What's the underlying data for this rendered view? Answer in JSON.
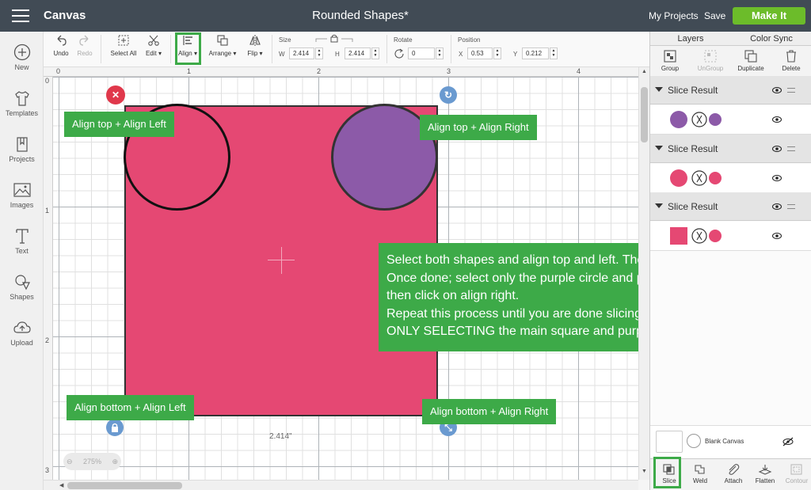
{
  "topbar": {
    "app_title": "Canvas",
    "document_title": "Rounded Shapes*",
    "my_projects": "My Projects",
    "save": "Save",
    "make_it": "Make It"
  },
  "left_rail": [
    {
      "label": "New",
      "icon": "plus-circle-icon"
    },
    {
      "label": "Templates",
      "icon": "tshirt-icon"
    },
    {
      "label": "Projects",
      "icon": "bookmark-icon"
    },
    {
      "label": "Images",
      "icon": "image-icon"
    },
    {
      "label": "Text",
      "icon": "text-icon"
    },
    {
      "label": "Shapes",
      "icon": "shapes-icon"
    },
    {
      "label": "Upload",
      "icon": "cloud-upload-icon"
    }
  ],
  "toolbar": {
    "undo": "Undo",
    "redo": "Redo",
    "select_all": "Select All",
    "edit": "Edit",
    "align": "Align",
    "arrange": "Arrange",
    "flip": "Flip",
    "size_label": "Size",
    "w_label": "W",
    "w_value": "2.414",
    "h_label": "H",
    "h_value": "2.414",
    "rotate_label": "Rotate",
    "rotate_value": "0",
    "position_label": "Position",
    "x_label": "X",
    "x_value": "0.53",
    "y_label": "Y",
    "y_value": "0.212"
  },
  "rulers": {
    "top": [
      "0",
      "1",
      "2",
      "3",
      "4"
    ],
    "left": [
      "0",
      "1",
      "2",
      "3"
    ]
  },
  "canvas": {
    "dimension_label": "2.414\"",
    "zoom_text": "275%"
  },
  "callouts": {
    "top_left": "Align top + Align Left",
    "top_right": "Align top + Align Right",
    "bottom_left": "Align bottom + Align Left",
    "bottom_right": "Align bottom + Align Right",
    "instructions": [
      "Select both shapes and align top and left.  Then click on slice.",
      "Once done; select only the purple circle and pink square, and",
      "then click on align right.",
      "Repeat this process until you are done slicing every corner.",
      "ONLY SELECTING the main square and purple circle."
    ]
  },
  "right_panel": {
    "tabs": [
      "Layers",
      "Color Sync"
    ],
    "actions": [
      {
        "label": "Group",
        "icon": "group-icon",
        "enabled": true
      },
      {
        "label": "UnGroup",
        "icon": "ungroup-icon",
        "enabled": false
      },
      {
        "label": "Duplicate",
        "icon": "duplicate-icon",
        "enabled": true
      },
      {
        "label": "Delete",
        "icon": "trash-icon",
        "enabled": true
      }
    ],
    "layer_groups": [
      {
        "label": "Slice Result",
        "color": "#8c5aa8",
        "thumb": "circle"
      },
      {
        "label": "Slice Result",
        "color": "#e54873",
        "thumb": "circle"
      },
      {
        "label": "Slice Result",
        "color": "#e54873",
        "thumb": "square"
      }
    ],
    "blank_canvas": "Blank Canvas",
    "bottom_actions": [
      {
        "label": "Slice",
        "icon": "slice-icon",
        "enabled": true
      },
      {
        "label": "Weld",
        "icon": "weld-icon",
        "enabled": true
      },
      {
        "label": "Attach",
        "icon": "attach-icon",
        "enabled": true
      },
      {
        "label": "Flatten",
        "icon": "flatten-icon",
        "enabled": true
      },
      {
        "label": "Contour",
        "icon": "contour-icon",
        "enabled": false
      }
    ]
  },
  "colors": {
    "accent_green": "#3daa48",
    "make_it_green": "#6cbc2a",
    "pink": "#e54873",
    "purple": "#8c5aa8",
    "topbar": "#414b55"
  }
}
